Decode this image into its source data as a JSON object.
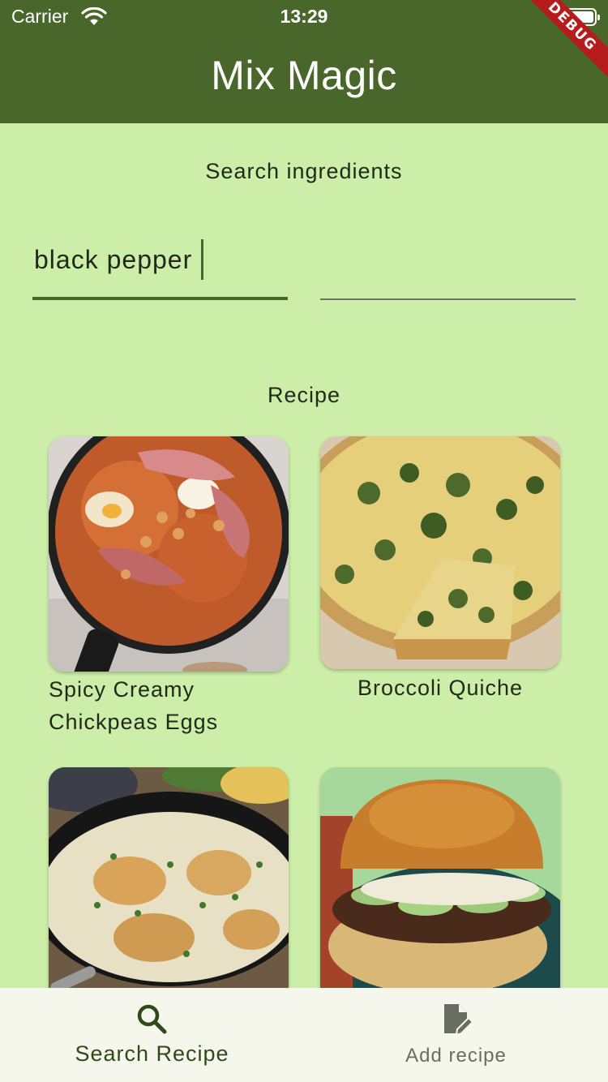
{
  "status_bar": {
    "carrier": "Carrier",
    "time": "13:29",
    "wifi_icon": "wifi-icon",
    "battery_icon": "battery-icon"
  },
  "app_bar": {
    "title": "Mix Magic",
    "debug_banner": "DEBUG",
    "color": "#49672b"
  },
  "search": {
    "label": "Search ingredients",
    "fields": [
      {
        "value": "black pepper",
        "placeholder": ""
      },
      {
        "value": "",
        "placeholder": ""
      }
    ]
  },
  "recipes": {
    "heading": "Recipe",
    "items": [
      {
        "title_line1": "Spicy Creamy",
        "title_line2": "Chickpeas Eggs",
        "image": "spicy-creamy-chickpeas-eggs-photo"
      },
      {
        "title_line1": "Broccoli Quiche",
        "title_line2": "",
        "image": "broccoli-quiche-photo"
      },
      {
        "title_line1": "",
        "title_line2": "",
        "image": "creamy-chicken-skillet-photo"
      },
      {
        "title_line1": "",
        "title_line2": "",
        "image": "burger-photo"
      }
    ]
  },
  "bottom_nav": {
    "items": [
      {
        "label": "Search Recipe",
        "icon": "search-icon",
        "active": true
      },
      {
        "label": "Add recipe",
        "icon": "edit-document-icon",
        "active": false
      }
    ]
  },
  "colors": {
    "background": "#cdeea8",
    "primary": "#49672b",
    "nav_background": "#f6f7ec",
    "debug": "#b71c1c"
  }
}
